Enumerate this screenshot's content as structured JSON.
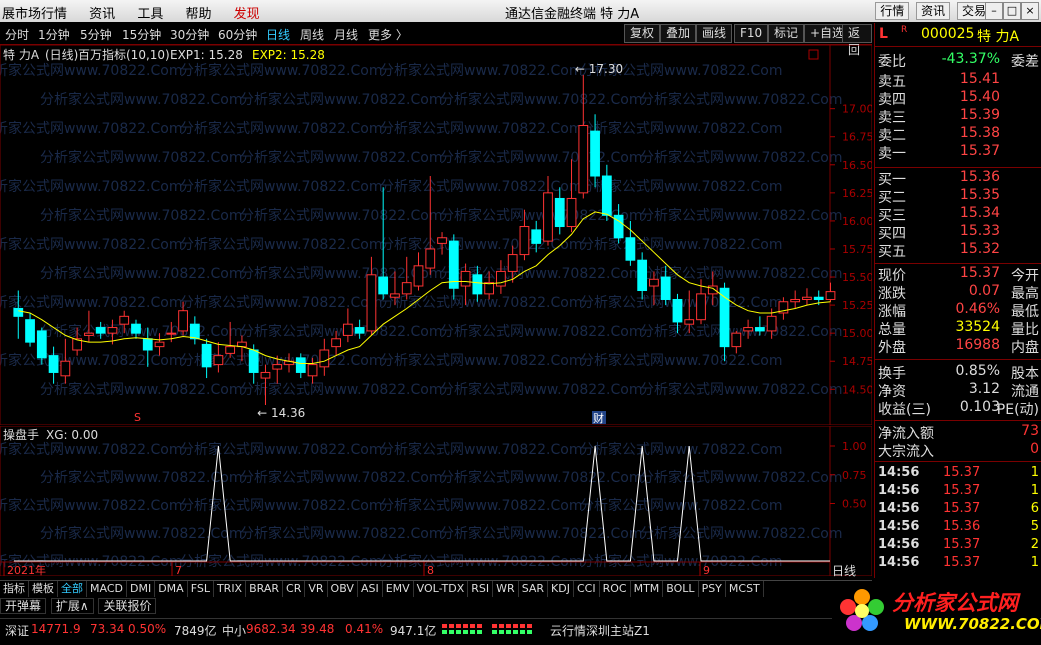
{
  "titlebar": {
    "menu": [
      "展市场行情",
      "资讯",
      "工具",
      "帮助",
      "发现"
    ],
    "app_title": "通达信金融终端  特 力A",
    "right_buttons": [
      "行情",
      "资讯",
      "交易"
    ],
    "window_buttons": [
      "minimize",
      "maximize",
      "close"
    ]
  },
  "periodbar": {
    "periods": [
      "分时",
      "1分钟",
      "5分钟",
      "15分钟",
      "30分钟",
      "60分钟",
      "日线",
      "周线",
      "月线",
      "更多 〉"
    ],
    "active": "日线",
    "tools": [
      "复权",
      "叠加",
      "画线",
      "F10",
      "标记",
      "+自选",
      "返回"
    ]
  },
  "chart_header": {
    "stock": "特 力A",
    "period": "(日线)",
    "indicator": "百万指标(10,10)",
    "exp1_label": "EXP1: 15.28",
    "exp2_label": "EXP2: 15.28"
  },
  "sub_header": {
    "name": "操盘手",
    "value_label": "XG: 0.00"
  },
  "chart_data": [
    {
      "type": "candlestick",
      "title": "特 力A (日线)",
      "y_ticks": [
        "17.00",
        "16.75",
        "16.50",
        "16.25",
        "16.00",
        "15.75",
        "15.50",
        "15.25",
        "15.00",
        "14.75",
        "14.50"
      ],
      "ylim": [
        14.36,
        17.3
      ],
      "annotations": [
        {
          "text": "17.30"
        },
        {
          "text": "14.36"
        },
        {
          "text": "S"
        },
        {
          "text": "财"
        }
      ],
      "x_labels": [
        "2021年",
        "7",
        "8",
        "9"
      ],
      "candles": [
        [
          15.22,
          15.15,
          15.38,
          14.95
        ],
        [
          15.12,
          14.92,
          15.18,
          14.88
        ],
        [
          15.02,
          14.78,
          15.05,
          14.72
        ],
        [
          14.8,
          14.65,
          14.88,
          14.55
        ],
        [
          14.62,
          14.75,
          14.95,
          14.55
        ],
        [
          14.85,
          14.95,
          15.05,
          14.8
        ],
        [
          14.98,
          15.0,
          15.2,
          14.92
        ],
        [
          15.05,
          15.0,
          15.1,
          14.95
        ],
        [
          15.0,
          15.05,
          15.12,
          14.9
        ],
        [
          15.08,
          15.15,
          15.2,
          15.0
        ],
        [
          15.08,
          15.0,
          15.12,
          14.95
        ],
        [
          14.95,
          14.85,
          15.05,
          14.7
        ],
        [
          14.88,
          14.92,
          15.0,
          14.8
        ],
        [
          15.0,
          15.0,
          15.1,
          14.92
        ],
        [
          15.02,
          15.2,
          15.28,
          14.98
        ],
        [
          15.08,
          14.95,
          15.15,
          14.9
        ],
        [
          14.9,
          14.7,
          14.95,
          14.6
        ],
        [
          14.72,
          14.8,
          14.92,
          14.65
        ],
        [
          14.82,
          14.88,
          15.1,
          14.78
        ],
        [
          14.88,
          14.92,
          14.98,
          14.75
        ],
        [
          14.85,
          14.65,
          14.9,
          14.55
        ],
        [
          14.6,
          14.65,
          14.72,
          14.36
        ],
        [
          14.68,
          14.72,
          14.8,
          14.55
        ],
        [
          14.72,
          14.75,
          14.82,
          14.65
        ],
        [
          14.78,
          14.65,
          14.82,
          14.6
        ],
        [
          14.62,
          14.72,
          14.78,
          14.55
        ],
        [
          14.7,
          14.85,
          14.95,
          14.62
        ],
        [
          14.88,
          14.95,
          15.02,
          14.8
        ],
        [
          14.98,
          15.08,
          15.22,
          14.92
        ],
        [
          15.05,
          15.0,
          15.12,
          14.95
        ],
        [
          15.02,
          15.52,
          15.68,
          14.98
        ],
        [
          15.5,
          15.35,
          16.3,
          15.3
        ],
        [
          15.32,
          15.35,
          15.55,
          15.25
        ],
        [
          15.35,
          15.45,
          15.68,
          15.3
        ],
        [
          15.42,
          15.6,
          15.72,
          15.38
        ],
        [
          15.58,
          15.75,
          16.4,
          15.52
        ],
        [
          15.8,
          15.85,
          15.9,
          15.7
        ],
        [
          15.82,
          15.4,
          15.88,
          15.3
        ],
        [
          15.42,
          15.55,
          15.62,
          15.25
        ],
        [
          15.52,
          15.35,
          15.6,
          15.28
        ],
        [
          15.35,
          15.45,
          15.55,
          15.3
        ],
        [
          15.42,
          15.55,
          15.65,
          15.35
        ],
        [
          15.55,
          15.7,
          15.78,
          15.45
        ],
        [
          15.7,
          15.95,
          16.1,
          15.65
        ],
        [
          15.92,
          15.8,
          16.0,
          15.72
        ],
        [
          15.82,
          16.25,
          16.4,
          15.78
        ],
        [
          16.2,
          15.95,
          16.3,
          15.88
        ],
        [
          15.95,
          16.2,
          16.55,
          15.9
        ],
        [
          16.25,
          16.85,
          17.3,
          16.2
        ],
        [
          16.8,
          16.4,
          16.95,
          16.3
        ],
        [
          16.4,
          16.05,
          16.5,
          16.0
        ],
        [
          16.05,
          15.85,
          16.15,
          15.8
        ],
        [
          15.85,
          15.65,
          16.0,
          15.6
        ],
        [
          15.65,
          15.38,
          15.72,
          15.3
        ],
        [
          15.42,
          15.48,
          15.55,
          15.25
        ],
        [
          15.5,
          15.3,
          15.6,
          15.25
        ],
        [
          15.3,
          15.1,
          15.35,
          15.0
        ],
        [
          15.08,
          15.12,
          15.38,
          15.0
        ],
        [
          15.12,
          15.35,
          15.48,
          15.08
        ],
        [
          15.35,
          15.42,
          15.55,
          15.25
        ],
        [
          15.4,
          14.88,
          15.45,
          14.75
        ],
        [
          14.88,
          15.0,
          15.02,
          14.82
        ],
        [
          15.02,
          15.05,
          15.12,
          14.95
        ],
        [
          15.05,
          15.02,
          15.15,
          14.98
        ],
        [
          15.02,
          15.15,
          15.22,
          14.95
        ],
        [
          15.18,
          15.28,
          15.32,
          15.12
        ],
        [
          15.28,
          15.3,
          15.38,
          15.22
        ],
        [
          15.3,
          15.32,
          15.4,
          15.25
        ],
        [
          15.32,
          15.3,
          15.38,
          15.25
        ],
        [
          15.3,
          15.37,
          15.45,
          15.28
        ]
      ],
      "ma_line": [
        15.2,
        15.18,
        15.12,
        15.05,
        14.98,
        14.94,
        14.92,
        14.92,
        14.93,
        14.95,
        14.96,
        14.95,
        14.94,
        14.95,
        14.97,
        14.96,
        14.93,
        14.9,
        14.89,
        14.88,
        14.85,
        14.8,
        14.77,
        14.75,
        14.73,
        14.73,
        14.75,
        14.8,
        14.85,
        14.88,
        14.98,
        15.08,
        15.15,
        15.22,
        15.3,
        15.38,
        15.45,
        15.46,
        15.46,
        15.45,
        15.44,
        15.45,
        15.48,
        15.55,
        15.6,
        15.7,
        15.78,
        15.88,
        16.02,
        16.08,
        16.06,
        16.0,
        15.92,
        15.82,
        15.72,
        15.62,
        15.52,
        15.45,
        15.42,
        15.4,
        15.32,
        15.25,
        15.2,
        15.18,
        15.18,
        15.2,
        15.22,
        15.25,
        15.27,
        15.28
      ]
    },
    {
      "type": "line",
      "title": "操盘手",
      "y_ticks": [
        "1.00",
        "0.75",
        "0.50"
      ],
      "ylim": [
        0,
        1
      ],
      "signal_indices": [
        17,
        49,
        53,
        57
      ],
      "x_labels": [
        "2021年",
        "7",
        "8",
        "9"
      ]
    }
  ],
  "right_panel": {
    "code": "000025",
    "name": "特 力A",
    "badge": "L",
    "r_mark": "R",
    "webi": {
      "label": "委比",
      "value": "-43.37%",
      "right": "委差"
    },
    "sell": [
      {
        "label": "卖五",
        "price": "15.41"
      },
      {
        "label": "卖四",
        "price": "15.40"
      },
      {
        "label": "卖三",
        "price": "15.39"
      },
      {
        "label": "卖二",
        "price": "15.38"
      },
      {
        "label": "卖一",
        "price": "15.37"
      }
    ],
    "buy": [
      {
        "label": "买一",
        "price": "15.36"
      },
      {
        "label": "买二",
        "price": "15.35"
      },
      {
        "label": "买三",
        "price": "15.34"
      },
      {
        "label": "买四",
        "price": "15.33"
      },
      {
        "label": "买五",
        "price": "15.32"
      }
    ],
    "stats": [
      {
        "label": "现价",
        "value": "15.37",
        "right": "今开"
      },
      {
        "label": "涨跌",
        "value": "0.07",
        "right": "最高"
      },
      {
        "label": "涨幅",
        "value": "0.46%",
        "right": "最低"
      },
      {
        "label": "总量",
        "value": "33524",
        "right": "量比"
      },
      {
        "label": "外盘",
        "value": "16988",
        "right": "内盘"
      }
    ],
    "stats2": [
      {
        "label": "换手",
        "value": "0.85%",
        "right": "股本"
      },
      {
        "label": "净资",
        "value": "3.12",
        "right": "流通"
      },
      {
        "label": "收益(三)",
        "value": "0.103",
        "right": "PE(动)"
      }
    ],
    "flow": [
      {
        "label": "净流入额",
        "value": "73"
      },
      {
        "label": "大宗流入",
        "value": "0"
      }
    ],
    "ticks": [
      {
        "time": "14:56",
        "price": "15.37",
        "vol": "1"
      },
      {
        "time": "14:56",
        "price": "15.37",
        "vol": "1"
      },
      {
        "time": "14:56",
        "price": "15.37",
        "vol": "6"
      },
      {
        "time": "14:56",
        "price": "15.36",
        "vol": "5"
      },
      {
        "time": "14:56",
        "price": "15.37",
        "vol": "2"
      },
      {
        "time": "14:56",
        "price": "15.37",
        "vol": "1"
      }
    ]
  },
  "indicator_tabs": [
    "指标",
    "模板",
    "全部",
    "MACD",
    "DMI",
    "DMA",
    "FSL",
    "TRIX",
    "BRAR",
    "CR",
    "VR",
    "OBV",
    "ASI",
    "EMV",
    "VOL-TDX",
    "RSI",
    "WR",
    "SAR",
    "KDJ",
    "CCI",
    "ROC",
    "MTM",
    "BOLL",
    "PSY",
    "MCST"
  ],
  "indicator_selected": "全部",
  "daily_label": "日线",
  "bottom_buttons": [
    "开弹幕",
    "扩展∧",
    "关联报价"
  ],
  "status": {
    "sz_label": "深证",
    "sz_value": "14771.9",
    "sz_change": "73.34",
    "sz_pct": "0.50%",
    "sz_amount": "7849亿",
    "zx_label": "中小",
    "zx_value": "9682.34",
    "zx_change": "39.48",
    "zx_pct": "0.41%",
    "zx_amount": "947.1亿",
    "server": "云行情深圳主站Z1"
  },
  "logo": {
    "text": "分析家公式网",
    "url": "WWW.70822.COM"
  },
  "watermark": "分析家公式网www.70822.Com",
  "colors": {
    "up": "#ff3333",
    "down": "#00ffff",
    "ma": "#ffff00",
    "grid": "#7a0000"
  }
}
